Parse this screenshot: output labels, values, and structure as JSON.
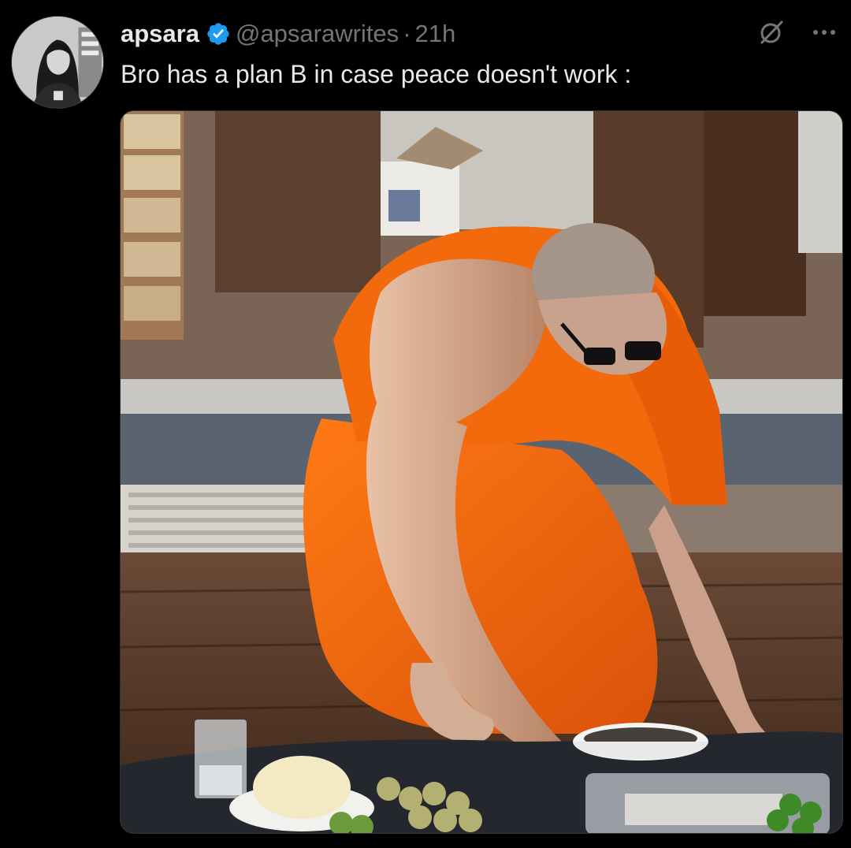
{
  "tweet": {
    "author": {
      "display_name": "apsara",
      "handle": "@apsarawrites",
      "verified": true
    },
    "separator": "·",
    "time": "21h",
    "text": "Bro has a plan B in case peace doesn't work :",
    "icons": {
      "verified": "verified-badge-icon",
      "grok": "grok-icon",
      "more": "more-options-icon"
    },
    "media": {
      "type": "photo"
    }
  },
  "colors": {
    "background": "#000000",
    "text_primary": "#e7e9ea",
    "text_secondary": "#71767b",
    "verified_blue": "#1d9bf0",
    "robe_orange": "#f26a0c"
  }
}
